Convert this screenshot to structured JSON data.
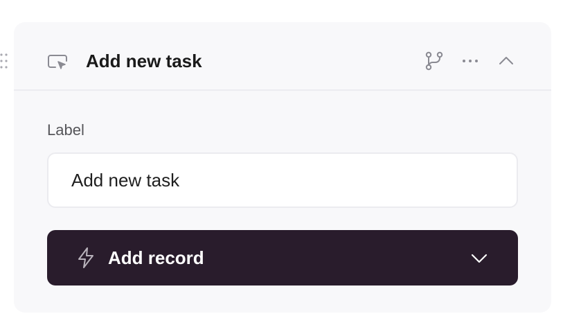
{
  "card": {
    "icon": "monitor-cursor-icon",
    "title": "Add new task",
    "header_actions": [
      {
        "icon": "git-branch-icon"
      },
      {
        "icon": "more-horizontal-icon"
      },
      {
        "icon": "chevron-up-icon"
      }
    ]
  },
  "form": {
    "label_field": {
      "label": "Label",
      "value": "Add new task"
    }
  },
  "action": {
    "icon": "lightning-bolt-icon",
    "label": "Add record",
    "dropdown_icon": "chevron-down-icon"
  },
  "colors": {
    "card_background": "#f8f8fa",
    "action_background": "#291c2c",
    "text_primary": "#1a1a1a",
    "text_secondary": "#555559"
  }
}
